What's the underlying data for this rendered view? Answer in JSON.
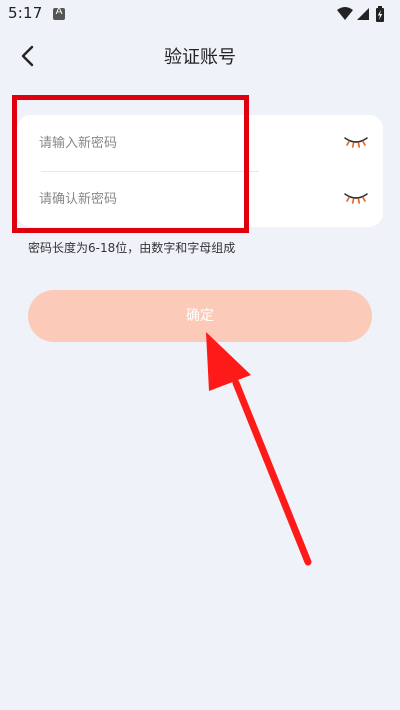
{
  "status_bar": {
    "time": "5:17",
    "notification_icon_letter": "A",
    "right_icons": [
      "wifi-icon",
      "signal-icon",
      "battery-charging-icon"
    ]
  },
  "header": {
    "title": "验证账号",
    "back_icon": "chevron-left-icon"
  },
  "form": {
    "new_password": {
      "placeholder": "请输入新密码",
      "value": "",
      "toggle_icon": "eye-closed-icon"
    },
    "confirm_password": {
      "placeholder": "请确认新密码",
      "value": "",
      "toggle_icon": "eye-closed-icon"
    }
  },
  "hint": "密码长度为6-18位，由数字和字母组成",
  "confirm_button": {
    "label": "确定",
    "state": "disabled"
  },
  "annotations": {
    "highlight_box_color": "#e0000d",
    "arrow_color": "#ff1a1a"
  },
  "colors": {
    "background": "#eff2f9",
    "card": "#ffffff",
    "button_fill": "#fbcab8",
    "eye_lid": "#333333",
    "eye_lash": "#e8601c"
  }
}
